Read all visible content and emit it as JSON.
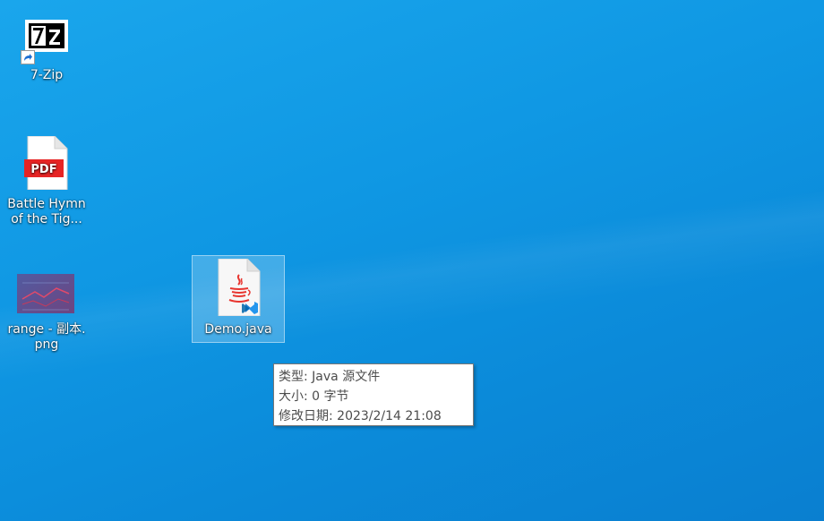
{
  "desktop": {
    "icons": [
      {
        "label_line1": "7-Zip",
        "label_line2": ""
      },
      {
        "label_line1": "Battle Hymn",
        "label_line2": "of the Tig..."
      },
      {
        "label_line1": "range - 副本.",
        "label_line2": "png"
      },
      {
        "label_line1": "Demo.java",
        "label_line2": ""
      }
    ],
    "zip_logo_text": "7z",
    "pdf_badge_text": "PDF"
  },
  "tooltip": {
    "type": "类型: Java 源文件",
    "size": "大小: 0 字节",
    "modified": "修改日期: 2023/2/14 21:08"
  },
  "colors": {
    "desktop_bg": "#0f97e3",
    "pdf_red": "#e62424",
    "java_red": "#e8352f",
    "vscode_blue": "#1f7fd3"
  }
}
